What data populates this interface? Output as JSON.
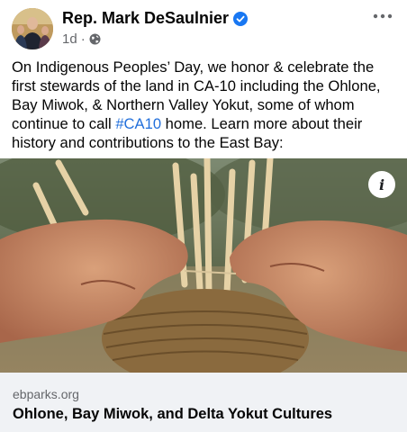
{
  "post": {
    "author": "Rep. Mark DeSaulnier",
    "time": "1d",
    "separator": "·",
    "text_before": "On Indigenous Peoples’ Day, we honor & celebrate the first stewards of the land in CA-10 including the Ohlone, Bay Miwok, & Northern Valley Yokut, some of whom continue to call ",
    "hashtag": "#CA10",
    "text_after": " home. Learn more about their history and contributions to the East Bay:"
  },
  "media": {
    "info_label": "i"
  },
  "link": {
    "domain": "ebparks.org",
    "title": "Ohlone, Bay Miwok, and Delta Yokut Cultures"
  },
  "icons": {
    "verified": "verified-badge-icon",
    "privacy": "globe-icon",
    "more": "more-options-icon",
    "info": "info-icon"
  },
  "colors": {
    "verified_blue": "#1877f2",
    "hashtag_blue": "#216fdb",
    "meta_gray": "#65676b",
    "card_bg": "#f0f2f5"
  }
}
